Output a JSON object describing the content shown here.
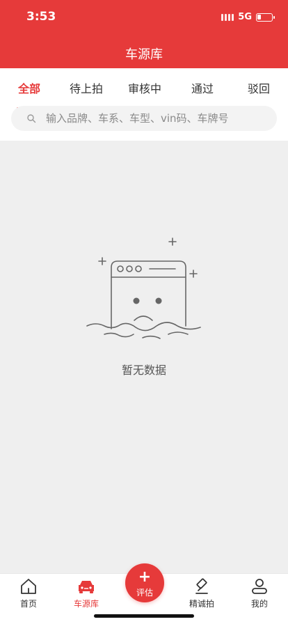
{
  "status_bar": {
    "time": "3:53",
    "network": "5G"
  },
  "header": {
    "title": "车源库"
  },
  "tabs": [
    {
      "label": "全部",
      "active": true
    },
    {
      "label": "待上拍",
      "active": false
    },
    {
      "label": "审核中",
      "active": false
    },
    {
      "label": "通过",
      "active": false
    },
    {
      "label": "驳回",
      "active": false
    }
  ],
  "search": {
    "placeholder": "输入品牌、车系、车型、vin码、车牌号",
    "value": ""
  },
  "empty_state": {
    "text": "暂无数据"
  },
  "tabbar": {
    "items": [
      {
        "label": "首页",
        "icon": "home-icon"
      },
      {
        "label": "车源库",
        "icon": "car-icon",
        "active": true
      },
      {
        "label": "精诚拍",
        "icon": "gavel-icon"
      },
      {
        "label": "我的",
        "icon": "user-icon"
      }
    ],
    "fab": {
      "label": "评估",
      "icon": "plus-icon"
    }
  },
  "colors": {
    "brand": "#e63a3a",
    "background": "#efefef"
  }
}
